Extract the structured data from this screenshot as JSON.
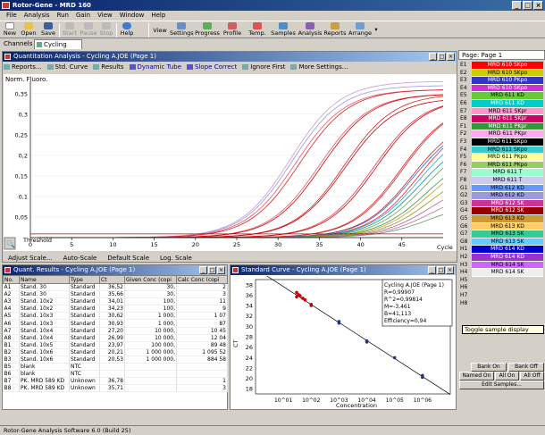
{
  "window": {
    "title": "Rotor-Gene - MRD 160"
  },
  "menu": [
    "File",
    "Analysis",
    "Run",
    "Gain",
    "View",
    "Window",
    "Help"
  ],
  "toolbar": {
    "left": [
      {
        "label": "New",
        "enabled": true
      },
      {
        "label": "Open",
        "enabled": true
      },
      {
        "label": "Save",
        "enabled": true
      },
      {
        "label": "Start",
        "enabled": false
      },
      {
        "label": "Pause",
        "enabled": false
      },
      {
        "label": "Stop",
        "enabled": false
      },
      {
        "label": "Help",
        "enabled": true
      }
    ],
    "view_label": "View",
    "right": [
      "Settings",
      "Progress",
      "Profile",
      "Temp.",
      "Samples",
      "Analysis",
      "Reports",
      "Arrange"
    ]
  },
  "channels": {
    "label": "Channels",
    "tab": "Cycling A.JOE"
  },
  "quant": {
    "title": "Quantitation Analysis - Cycling A.JOE (Page 1)",
    "tools": [
      "Reports...",
      "Std. Curve",
      "Results",
      "Dynamic Tube",
      "Slope Correct",
      "Ignore First",
      "More Settings..."
    ],
    "ylabel": "Norm. Fluoro.",
    "threshold_label": "Threshold",
    "x_unit": "Cycle",
    "bottom": [
      "Adjust Scale...",
      "Auto-Scale",
      "Default Scale",
      "Log. Scale"
    ]
  },
  "chart_data": [
    {
      "type": "line",
      "title": "",
      "xlabel": "Cycle",
      "ylabel": "Norm. Fluoro.",
      "xlim": [
        0,
        50
      ],
      "ylim": [
        0,
        0.38
      ],
      "xticks": [
        0,
        5,
        10,
        15,
        20,
        25,
        30,
        35,
        40,
        45
      ],
      "yticks": [
        0.05,
        0.1,
        0.15,
        0.2,
        0.25,
        0.3,
        0.35
      ],
      "threshold": 0.009,
      "curves": [
        {
          "ct": 20.2,
          "plateau": 0.38,
          "color": "#cc99cc"
        },
        {
          "ct": 20.5,
          "plateau": 0.37,
          "color": "#9999dd"
        },
        {
          "ct": 21.0,
          "plateau": 0.36,
          "color": "#ee5566"
        },
        {
          "ct": 21.5,
          "plateau": 0.36,
          "color": "#dd2222"
        },
        {
          "ct": 23.97,
          "plateau": 0.35,
          "color": "#ee5566"
        },
        {
          "ct": 24.3,
          "plateau": 0.35,
          "color": "#cc0000"
        },
        {
          "ct": 26.99,
          "plateau": 0.35,
          "color": "#dd2222"
        },
        {
          "ct": 27.2,
          "plateau": 0.34,
          "color": "#cc0000"
        },
        {
          "ct": 30.62,
          "plateau": 0.34,
          "color": "#ee3344"
        },
        {
          "ct": 30.93,
          "plateau": 0.34,
          "color": "#cc0000"
        },
        {
          "ct": 34.01,
          "plateau": 0.33,
          "color": "#dd2222"
        },
        {
          "ct": 34.23,
          "plateau": 0.33,
          "color": "#cc3333"
        },
        {
          "ct": 35.71,
          "plateau": 0.3,
          "color": "#cc2222"
        },
        {
          "ct": 35.9,
          "plateau": 0.29,
          "color": "#3366cc"
        },
        {
          "ct": 36.52,
          "plateau": 0.3,
          "color": "#ee2222"
        },
        {
          "ct": 36.78,
          "plateau": 0.28,
          "color": "#4499cc"
        },
        {
          "ct": 37.2,
          "plateau": 0.26,
          "color": "#009999"
        },
        {
          "ct": 37.8,
          "plateau": 0.25,
          "color": "#66aa33"
        },
        {
          "ct": 38.5,
          "plateau": 0.22,
          "color": "#339944"
        },
        {
          "ct": 39.0,
          "plateau": 0.21,
          "color": "#cc9933"
        },
        {
          "ct": 39.6,
          "plateau": 0.18,
          "color": "#999900"
        },
        {
          "ct": 40.3,
          "plateau": 0.15,
          "color": "#aa66aa"
        },
        {
          "ct": 41.0,
          "plateau": 0.12,
          "color": "#cc6699"
        },
        {
          "ct": 41.8,
          "plateau": 0.09,
          "color": "#669966"
        }
      ]
    },
    {
      "type": "scatter",
      "title": "",
      "xlabel": "Concentration",
      "ylabel": "CT",
      "log_x": true,
      "xlim": [
        1,
        10000000
      ],
      "ylim": [
        17,
        39
      ],
      "xtick_labels": [
        "10^01",
        "10^02",
        "10^03",
        "10^04",
        "10^05",
        "10^06"
      ],
      "yticks": [
        18,
        20,
        22,
        24,
        26,
        28,
        30,
        32,
        34,
        36,
        38
      ],
      "fit": {
        "M": -3.461,
        "B": 41.113
      },
      "points": [
        {
          "x": 30,
          "y": 36.52
        },
        {
          "x": 30,
          "y": 35.66
        },
        {
          "x": 100,
          "y": 34.01
        },
        {
          "x": 100,
          "y": 34.23
        },
        {
          "x": 1000,
          "y": 30.62
        },
        {
          "x": 1000,
          "y": 30.93
        },
        {
          "x": 10000,
          "y": 27.2
        },
        {
          "x": 10000,
          "y": 26.99
        },
        {
          "x": 100000,
          "y": 23.97
        },
        {
          "x": 1000000,
          "y": 20.21
        },
        {
          "x": 1000000,
          "y": 20.53
        },
        {
          "x": 40,
          "y": 35.9
        },
        {
          "x": 35,
          "y": 36.1
        },
        {
          "x": 50,
          "y": 35.4
        },
        {
          "x": 60,
          "y": 35.1
        }
      ]
    }
  ],
  "results": {
    "title": "Quant. Results - Cycling A.JOE (Page 1)",
    "columns": [
      "No.",
      "Name",
      "Type",
      "Ct",
      "Given Conc (copi",
      "Calc Conc (copi"
    ],
    "rows": [
      [
        "A1",
        "Stand. 30",
        "Standard",
        "36,52",
        "30,",
        "2"
      ],
      [
        "A2",
        "Stand. 30",
        "Standard",
        "35,66",
        "30,",
        "3"
      ],
      [
        "A3",
        "Stand. 10x2",
        "Standard",
        "34,01",
        "100,",
        "11"
      ],
      [
        "A4",
        "Stand. 10x2",
        "Standard",
        "34,23",
        "100,",
        "9"
      ],
      [
        "A5",
        "Stand. 10x3",
        "Standard",
        "30,62",
        "1 000,",
        "1 07"
      ],
      [
        "A6",
        "Stand. 10x3",
        "Standard",
        "30,93",
        "1 000,",
        "87"
      ],
      [
        "A7",
        "Stand. 10x4",
        "Standard",
        "27,20",
        "10 000,",
        "10 45"
      ],
      [
        "A8",
        "Stand. 10x4",
        "Standard",
        "26,99",
        "10 000,",
        "12 04"
      ],
      [
        "B1",
        "Stand. 10x5",
        "Standard",
        "23,97",
        "100 000,",
        "89 48"
      ],
      [
        "B2",
        "Stand. 10x6",
        "Standard",
        "20,21",
        "1 000 000,",
        "1 095 52"
      ],
      [
        "B3",
        "Stand. 10x6",
        "Standard",
        "20,53",
        "1 000 000,",
        "884 58"
      ],
      [
        "B5",
        "blank",
        "NTC",
        "",
        "",
        ""
      ],
      [
        "B6",
        "blank",
        "NTC",
        "",
        "",
        ""
      ],
      [
        "B7",
        "PK. MRD 589 KD",
        "Unknown",
        "36,78",
        "",
        "1"
      ],
      [
        "B8",
        "PK. MRD 589 KD",
        "Unknown",
        "35,71",
        "",
        "3"
      ]
    ]
  },
  "stdcurve": {
    "title": "Standard Curve - Cycling A.JOE (Page 1)",
    "info": [
      "Cycling A.JOE (Page 1)",
      "R=0,99907",
      "R^2=0,99814",
      "M=-3,461",
      "B=41,113",
      "Efficiency=0,94"
    ]
  },
  "samples": {
    "header": "Page: Page 1",
    "items": [
      {
        "id": "E1",
        "name": "MRD 610 SKpo",
        "bg": "#ff0000",
        "fg": "#ffffff"
      },
      {
        "id": "E2",
        "name": "MRD 610 SKpo",
        "bg": "#cccc00",
        "fg": "#000000"
      },
      {
        "id": "E3",
        "name": "MRD 610 PKpo",
        "bg": "#3333cc",
        "fg": "#ffffff"
      },
      {
        "id": "E4",
        "name": "MRD 610 SKpo",
        "bg": "#cc33cc",
        "fg": "#ffffff"
      },
      {
        "id": "E5",
        "name": "MRD 611 KD",
        "bg": "#66cc33",
        "fg": "#000000"
      },
      {
        "id": "E6",
        "name": "MRD 611 KD",
        "bg": "#00cccc",
        "fg": "#ffffff"
      },
      {
        "id": "E7",
        "name": "MRD 611 SKpr",
        "bg": "#ff99cc",
        "fg": "#000000"
      },
      {
        "id": "E8",
        "name": "MRD 611 SKpr",
        "bg": "#cc0066",
        "fg": "#ffffff"
      },
      {
        "id": "F1",
        "name": "MRD 611 PKpr",
        "bg": "#339933",
        "fg": "#ffffff"
      },
      {
        "id": "F2",
        "name": "MRD 611 PKpr",
        "bg": "#ffaaee",
        "fg": "#000000"
      },
      {
        "id": "F3",
        "name": "MRD 611 SKpo",
        "bg": "#000000",
        "fg": "#ffffff"
      },
      {
        "id": "F4",
        "name": "MRD 611 SKpo",
        "bg": "#33cccc",
        "fg": "#000000"
      },
      {
        "id": "F5",
        "name": "MRD 611 PKpo",
        "bg": "#ffff99",
        "fg": "#000000"
      },
      {
        "id": "F6",
        "name": "MRD 611 PKpo",
        "bg": "#99cc66",
        "fg": "#000000"
      },
      {
        "id": "F7",
        "name": "MRD 611 T",
        "bg": "#99ffcc",
        "fg": "#000000"
      },
      {
        "id": "F8",
        "name": "MRD 611 T",
        "bg": "#ccccee",
        "fg": "#000000"
      },
      {
        "id": "G1",
        "name": "MRD 612 KD",
        "bg": "#6699ff",
        "fg": "#000000"
      },
      {
        "id": "G2",
        "name": "MRD 612 KD",
        "bg": "#9999dd",
        "fg": "#000000"
      },
      {
        "id": "G3",
        "name": "MRD 612 SK",
        "bg": "#cc3399",
        "fg": "#ffffff"
      },
      {
        "id": "G4",
        "name": "MRD 612 SK",
        "bg": "#990000",
        "fg": "#ffffff"
      },
      {
        "id": "G5",
        "name": "MRD 613 KD",
        "bg": "#cc9933",
        "fg": "#000000"
      },
      {
        "id": "G6",
        "name": "MRD 613 KD",
        "bg": "#ffcc66",
        "fg": "#000000"
      },
      {
        "id": "G7",
        "name": "MRD 613 SK",
        "bg": "#33cc99",
        "fg": "#000000"
      },
      {
        "id": "G8",
        "name": "MRD 613 SK",
        "bg": "#66ccff",
        "fg": "#000000"
      },
      {
        "id": "H1",
        "name": "MRD 614 KD",
        "bg": "#0000cc",
        "fg": "#ffffff"
      },
      {
        "id": "H2",
        "name": "MRD 614 KD",
        "bg": "#9933cc",
        "fg": "#ffffff"
      },
      {
        "id": "H3",
        "name": "MRD 614 SK",
        "bg": "#cc66ff",
        "fg": "#000000"
      },
      {
        "id": "H4",
        "name": "MRD 614 SK",
        "bg": "#eeeeee",
        "fg": "#000000"
      }
    ],
    "extra_ids": [
      "H5",
      "H6",
      "H7",
      "H8"
    ],
    "tooltip": "Toggle sample display",
    "buttons": {
      "bank_on": "Bank On",
      "bank_off": "Bank Off",
      "named_on": "Named On",
      "all_on": "All On",
      "all_off": "All Off",
      "edit": "Edit Samples..."
    }
  },
  "status": "Rotor-Gene Analysis Software 6.0 (Build 25)"
}
